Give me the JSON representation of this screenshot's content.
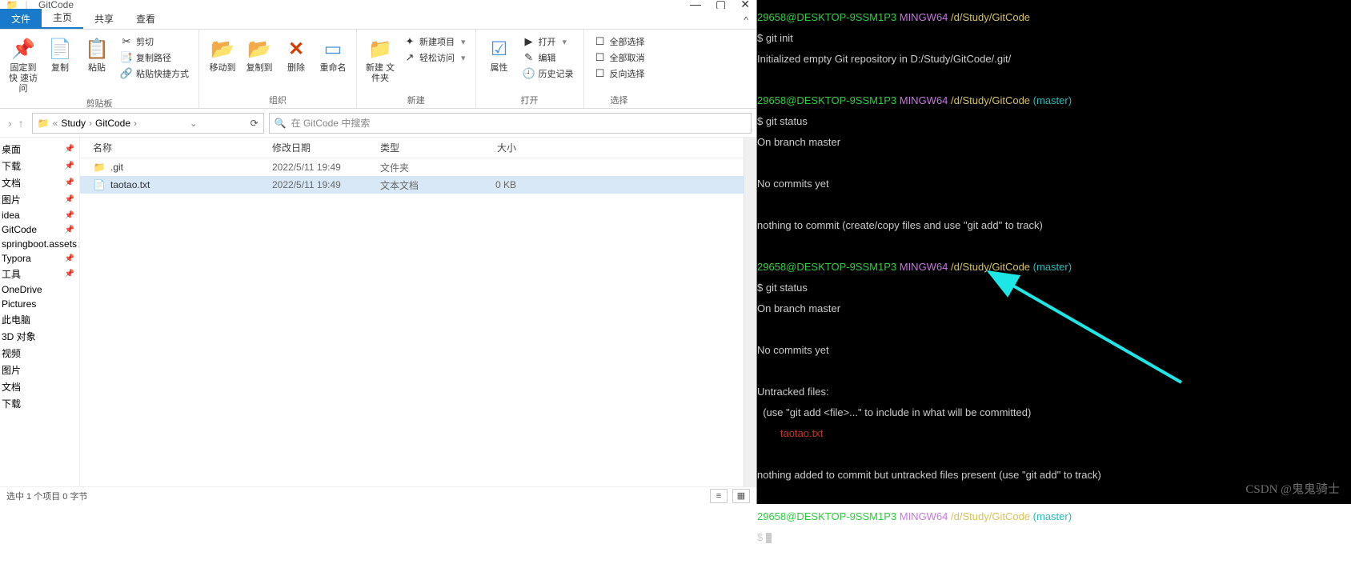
{
  "titlebar": {
    "title": "GitCode"
  },
  "tabs": {
    "file": "文件",
    "home": "主页",
    "share": "共享",
    "view": "查看"
  },
  "ribbon": {
    "clipboard": {
      "pin": "固定到快\n速访问",
      "copy": "复制",
      "paste": "粘贴",
      "cut": "剪切",
      "copy_path": "复制路径",
      "paste_shortcut": "粘贴快捷方式",
      "label": "剪贴板"
    },
    "organize": {
      "move_to": "移动到",
      "copy_to": "复制到",
      "delete": "删除",
      "rename": "重命名",
      "label": "组织"
    },
    "new": {
      "new_folder": "新建\n文件夹",
      "new_item": "新建项目",
      "easy_access": "轻松访问",
      "label": "新建"
    },
    "open": {
      "properties": "属性",
      "open": "打开",
      "edit": "编辑",
      "history": "历史记录",
      "label": "打开"
    },
    "select": {
      "select_all": "全部选择",
      "select_none": "全部取消",
      "invert": "反向选择",
      "label": "选择"
    }
  },
  "address": {
    "seg1": "Study",
    "seg2": "GitCode",
    "search_placeholder": "在 GitCode 中搜索"
  },
  "nav_items": [
    "桌面",
    "下载",
    "文档",
    "图片",
    "idea",
    "GitCode",
    "springboot.assets",
    "Typora",
    "工具",
    "OneDrive",
    "Pictures",
    "此电脑",
    "3D 对象",
    "视频",
    "图片",
    "文档",
    "下载"
  ],
  "columns": {
    "name": "名称",
    "date": "修改日期",
    "type": "类型",
    "size": "大小"
  },
  "rows": [
    {
      "name": ".git",
      "date": "2022/5/11 19:49",
      "type": "文件夹",
      "size": "",
      "icon": "folder"
    },
    {
      "name": "taotao.txt",
      "date": "2022/5/11 19:49",
      "type": "文本文档",
      "size": "0 KB",
      "icon": "file"
    }
  ],
  "status": {
    "text": "选中 1 个项目  0 字节"
  },
  "term": {
    "prompt_user": "29658@DESKTOP-9SSM1P3",
    "prompt_sys": "MINGW64",
    "path1": "/d/Study/GitCode",
    "path2": "/d/Study/GitCode",
    "branch": "(master)",
    "cmd_init": "$ git init",
    "init_out": "Initialized empty Git repository in D:/Study/GitCode/.git/",
    "cmd_status": "$ git status",
    "on_branch": "On branch master",
    "no_commits": "No commits yet",
    "nothing1": "nothing to commit (create/copy files and use \"git add\" to track)",
    "untracked_hdr": "Untracked files:",
    "untracked_hint": "  (use \"git add <file>...\" to include in what will be committed)",
    "untracked_file": "        taotao.txt",
    "nothing2": "nothing added to commit but untracked files present (use \"git add\" to track)",
    "dollar": "$ "
  },
  "watermark": "CSDN @鬼鬼骑士"
}
